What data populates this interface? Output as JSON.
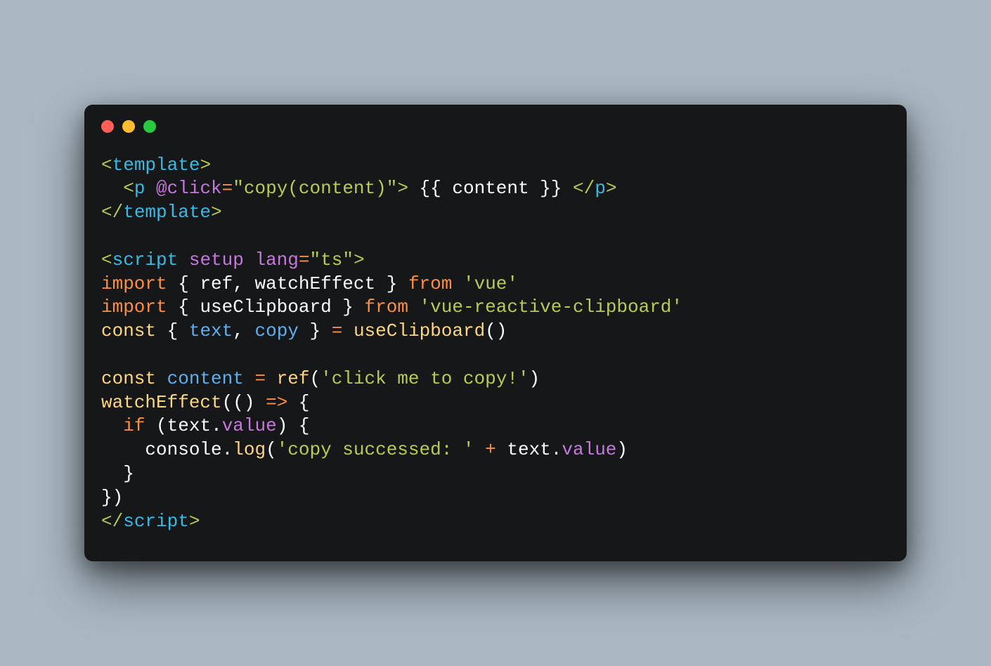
{
  "window": {
    "controls": {
      "red": "#ff5f56",
      "yellow": "#ffbd2e",
      "green": "#27c93f"
    }
  },
  "theme": {
    "background": "#abb8c3",
    "editor_bg": "#151718",
    "tag": "#b8cc52",
    "tagname": "#39bae6",
    "attr": "#c678dd",
    "string": "#b8cc52",
    "kw": "#ff8f40",
    "kw2": "#ffd580",
    "decl": "#61afef",
    "fn": "#ffd580",
    "ident": "#fdfefe",
    "op": "#ff8f40"
  },
  "code": {
    "line01": {
      "lt": "<",
      "tag_template": "template",
      "gt": ">"
    },
    "line02": {
      "indent": "  ",
      "lt": "<",
      "tag_p": "p",
      "space": " ",
      "attr_click": "@click",
      "eq": "=",
      "q1": "\"",
      "s_copy": "copy(content)",
      "q2": "\"",
      "gt": ">",
      "txt": " {{ content }} ",
      "lt2": "</",
      "tag_p2": "p",
      "gt2": ">"
    },
    "line03": {
      "lt": "</",
      "tag_template": "template",
      "gt": ">"
    },
    "blank1": "",
    "line05": {
      "lt": "<",
      "tag_script": "script",
      "sp1": " ",
      "attr_setup": "setup",
      "sp2": " ",
      "attr_lang": "lang",
      "eq": "=",
      "q1": "\"",
      "s_ts": "ts",
      "q2": "\"",
      "gt": ">"
    },
    "line06": {
      "kw_import": "import",
      "sp1": " ",
      "lb": "{ ",
      "id_ref": "ref",
      "comma": ", ",
      "id_we": "watchEffect",
      "rb": " }",
      "sp2": " ",
      "kw_from": "from",
      "sp3": " ",
      "str_vue": "'vue'"
    },
    "line07": {
      "kw_import": "import",
      "sp1": " ",
      "lb": "{ ",
      "id_uc": "useClipboard",
      "rb": " }",
      "sp2": " ",
      "kw_from": "from",
      "sp3": " ",
      "str_pkg": "'vue-reactive-clipboard'"
    },
    "line08": {
      "kw_const": "const",
      "sp1": " ",
      "lb": "{ ",
      "id_text": "text",
      "comma": ", ",
      "id_copy": "copy",
      "rb": " }",
      "sp2": " ",
      "eq": "=",
      "sp3": " ",
      "fn_uc": "useClipboard",
      "parens": "()"
    },
    "blank2": "",
    "line10": {
      "kw_const": "const",
      "sp1": " ",
      "id_content": "content",
      "sp2": " ",
      "eq": "=",
      "sp3": " ",
      "fn_ref": "ref",
      "po": "(",
      "str_click": "'click me to copy!'",
      "pc": ")"
    },
    "line11": {
      "fn_we": "watchEffect",
      "po": "((",
      "pc2": ")",
      "sp": " ",
      "arrow": "=>",
      "sp2": " ",
      "lb": "{"
    },
    "line12": {
      "indent": "  ",
      "kw_if": "if",
      "sp": " ",
      "po": "(",
      "id_text": "text",
      "dot": ".",
      "prop_value": "value",
      "pc": ")",
      "sp2": " ",
      "lb": "{"
    },
    "line13": {
      "indent": "    ",
      "id_console": "console",
      "dot": ".",
      "fn_log": "log",
      "po": "(",
      "str": "'copy successed: '",
      "sp": " ",
      "plus": "+",
      "sp2": " ",
      "id_text": "text",
      "dot2": ".",
      "prop_value": "value",
      "pc": ")"
    },
    "line14": {
      "indent": "  ",
      "rb": "}"
    },
    "line15": {
      "rb": "})"
    },
    "line16": {
      "lt": "</",
      "tag_script": "script",
      "gt": ">"
    }
  }
}
